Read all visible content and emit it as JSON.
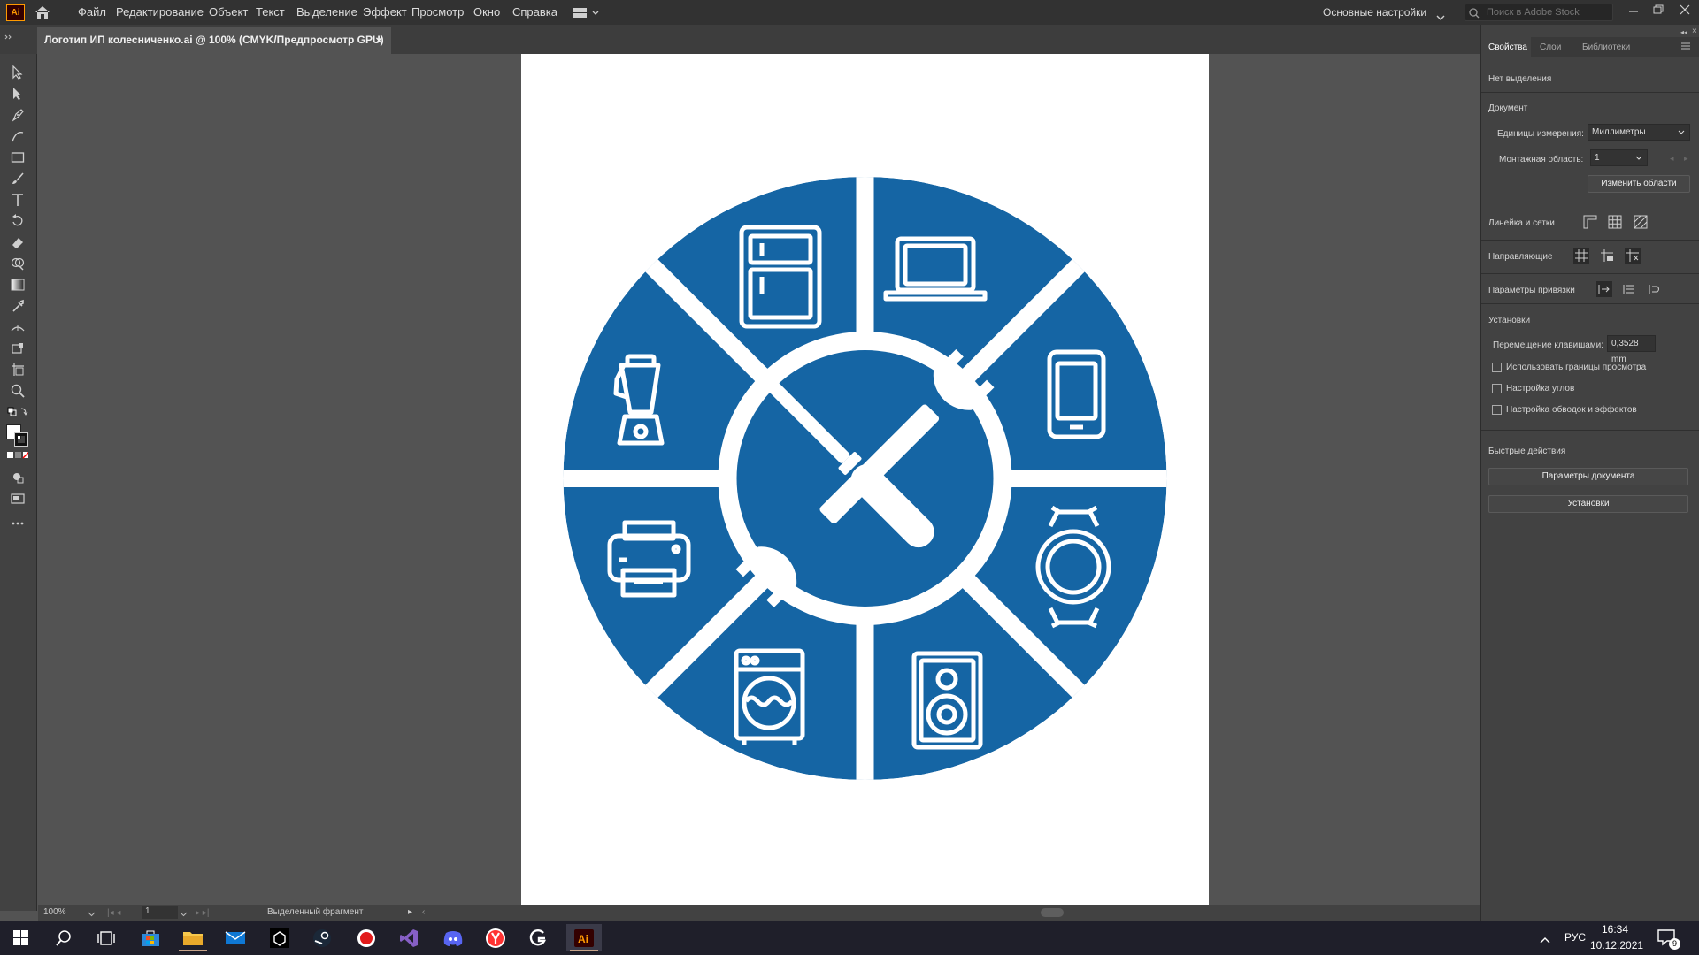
{
  "app": {
    "logo_text": "Ai",
    "menu": [
      "Файл",
      "Редактирование",
      "Объект",
      "Текст",
      "Выделение",
      "Эффект",
      "Просмотр",
      "Окно",
      "Справка"
    ],
    "workspace_label": "Основные настройки",
    "search_placeholder": "Поиск в Adobe Stock"
  },
  "document_tab": {
    "title": "Логотип ИП колесниченко.ai @ 100% (CMYK/Предпросмотр GPU)",
    "close_glyph": "×"
  },
  "tools": [
    "selection-tool",
    "direct-selection-tool",
    "pen-tool",
    "curvature-tool",
    "rectangle-tool",
    "paintbrush-tool",
    "type-tool",
    "rotate-tool",
    "eraser-tool",
    "shape-builder-tool",
    "gradient-tool",
    "eyedropper-tool",
    "width-tool",
    "free-transform-tool",
    "artboard-tool",
    "zoom-tool"
  ],
  "artwork": {
    "brand_color": "#1565a4",
    "segments": [
      "refrigerator",
      "laptop",
      "smartphone",
      "smartwatch",
      "speaker",
      "washing-machine",
      "printer",
      "blender"
    ],
    "center": "wrench-and-screwdriver"
  },
  "statusbar": {
    "zoom": "100%",
    "artboard_number": "1",
    "status_text": "Выделенный фрагмент"
  },
  "panel": {
    "tabs": [
      "Свойства",
      "Слои",
      "Библиотеки"
    ],
    "no_selection": "Нет выделения",
    "document_heading": "Документ",
    "units_label": "Единицы измерения:",
    "units_value": "Миллиметры",
    "artboards_label": "Монтажная область:",
    "artboards_value": "1",
    "edit_artboards_button": "Изменить области",
    "rulers_label": "Линейка и сетки",
    "guides_label": "Направляющие",
    "snap_label": "Параметры привязки",
    "preferences_heading": "Установки",
    "keyboard_increment_label": "Перемещение клавишами:",
    "keyboard_increment_value": "0,3528 mm",
    "checkboxes": [
      "Использовать границы просмотра",
      "Настройка углов",
      "Настройка обводок и эффектов"
    ],
    "quick_actions_heading": "Быстрые действия",
    "doc_setup_button": "Параметры документа",
    "preferences_button": "Установки"
  },
  "taskbar": {
    "language": "РУС",
    "time": "16:34",
    "date": "10.12.2021",
    "notifications_count": "9",
    "apps": [
      "start",
      "search",
      "task-view",
      "store",
      "file-explorer",
      "mail",
      "unity",
      "steam",
      "recorder",
      "visual-studio",
      "discord",
      "yandex-browser",
      "logitech-g",
      "illustrator"
    ]
  }
}
